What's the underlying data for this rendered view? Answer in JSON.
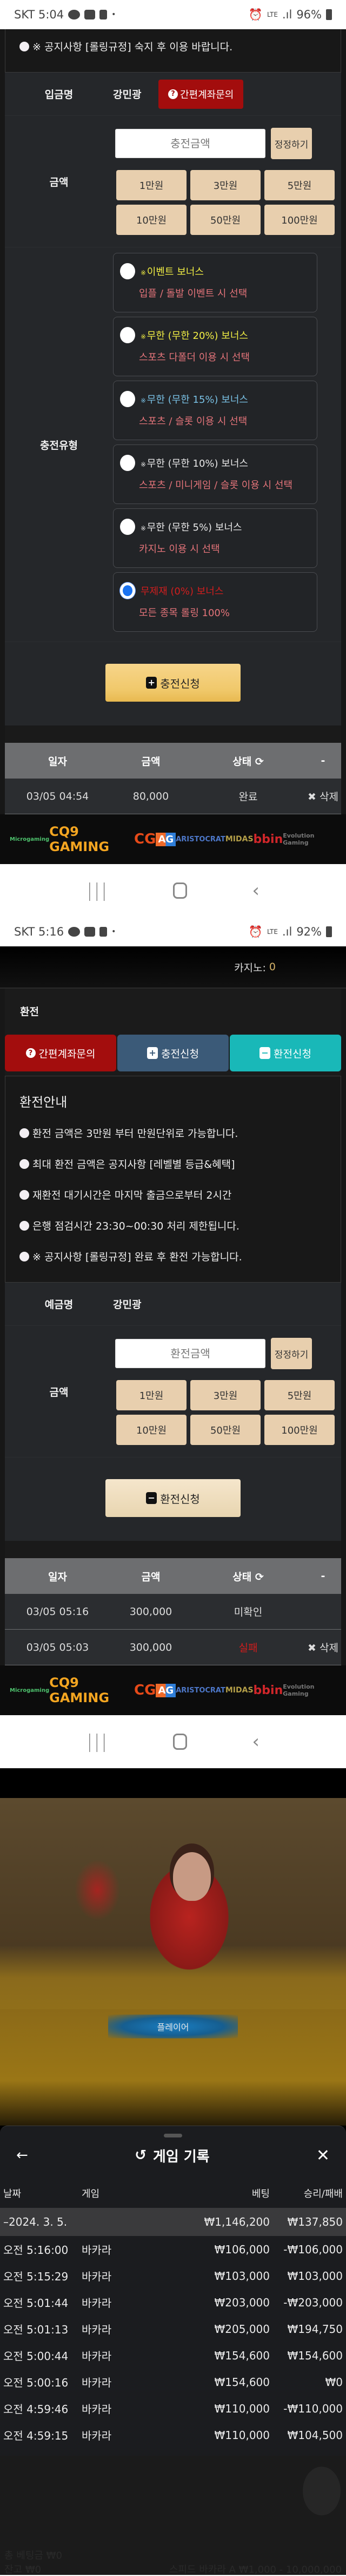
{
  "screen1": {
    "status": {
      "carrier_time": "SKT 5:04",
      "network": "LTE",
      "battery": "96%"
    },
    "notice": "※ 공지사항 [롤링규정] 숙지 후 이용 바랍니다.",
    "depositor_label": "입금명",
    "depositor_name": "강민광",
    "inquiry_button": "간편계좌문의",
    "amount_label": "금액",
    "amount_placeholder": "충전금액",
    "fix_button": "정정하기",
    "chips": [
      "1만원",
      "3만원",
      "5만원",
      "10만원",
      "50만원",
      "100만원"
    ],
    "charge_type_label": "충전유형",
    "bonus_options": [
      {
        "title": "이벤트 보너스",
        "prefix": "※",
        "desc": "입플 / 돌발 이벤트 시 선택",
        "color": "#f2ef44",
        "selected": false
      },
      {
        "title": "무한 (무한 20%) 보너스",
        "prefix": "※",
        "desc": "스포츠 다폴더 이용 시 선택",
        "color": "#f2ef44",
        "selected": false
      },
      {
        "title": "무한 (무한 15%) 보너스",
        "prefix": "※",
        "desc": "스포츠 / 슬롯 이용 시 선택",
        "color": "#7ac2e6",
        "selected": false
      },
      {
        "title": "무한 (무한 10%) 보너스",
        "prefix": "※",
        "desc": "스포츠 / 미니게임 / 슬롯 이용 시 선택",
        "color": "#e9e9e9",
        "selected": false
      },
      {
        "title": "무한 (무한 5%) 보너스",
        "prefix": "※",
        "desc": "카지노 이용 시 선택",
        "color": "#e9e9e9",
        "selected": false
      },
      {
        "title": "무제재 (0%) 보너스",
        "prefix": "",
        "desc": "모든 종목 롤링 100%",
        "color": "#d11e1e",
        "selected": true
      }
    ],
    "submit_button": "충전신청",
    "table": {
      "headers": [
        "일자",
        "금액",
        "상태",
        "-"
      ],
      "rows": [
        {
          "date": "03/05 04:54",
          "amount": "80,000",
          "status": "완료",
          "action": "삭제"
        }
      ]
    }
  },
  "providers": [
    "Microgaming",
    "CQ9 GAMING",
    "CG",
    "AG",
    "ARISTOCRAT",
    "MIDAS",
    "bbin",
    "Evolution Gaming"
  ],
  "screen2": {
    "status": {
      "carrier_time": "SKT 5:16",
      "network": "LTE",
      "battery": "92%"
    },
    "casino_label": "카지노:",
    "casino_value": "0",
    "section_title": "환전",
    "tabs": [
      "간편계좌문의",
      "충전신청",
      "환전신청"
    ],
    "info_title": "환전안내",
    "info_items": [
      "환전 금액은 3만원 부터 만원단위로 가능합니다.",
      "최대 환전 금액은 공지사항 [레벨별 등급&혜택]",
      "재환전 대기시간은 마지막 출금으로부터 2시간",
      "은행 점검시간 23:30~00:30 처리 제한됩니다.",
      "※ 공지사항 [롤링규정] 완료 후 환전 가능합니다."
    ],
    "account_label": "예금명",
    "account_name": "강민광",
    "amount_label": "금액",
    "amount_placeholder": "환전금액",
    "fix_button": "정정하기",
    "chips": [
      "1만원",
      "3만원",
      "5만원",
      "10만원",
      "50만원",
      "100만원"
    ],
    "submit_button": "환전신청",
    "table": {
      "headers": [
        "일자",
        "금액",
        "상태",
        "-"
      ],
      "rows": [
        {
          "date": "03/05 05:16",
          "amount": "300,000",
          "status": "미확인",
          "action": ""
        },
        {
          "date": "03/05 05:03",
          "amount": "300,000",
          "status": "실패",
          "action": "삭제"
        }
      ]
    }
  },
  "screen3": {
    "bet_spot_label": "플레이어",
    "sheet_title": "게임 기록",
    "columns": [
      "날짜",
      "게임",
      "베팅",
      "승리/패배"
    ],
    "total": {
      "date": "–2024. 3. 5.",
      "bet": "₩1,146,200",
      "result": "₩137,850"
    },
    "records": [
      {
        "time": "오전 5:16:00",
        "game": "바카라",
        "bet": "₩106,000",
        "result": "-₩106,000"
      },
      {
        "time": "오전 5:15:29",
        "game": "바카라",
        "bet": "₩103,000",
        "result": "₩103,000"
      },
      {
        "time": "오전 5:01:44",
        "game": "바카라",
        "bet": "₩203,000",
        "result": "-₩203,000"
      },
      {
        "time": "오전 5:01:13",
        "game": "바카라",
        "bet": "₩205,000",
        "result": "₩194,750"
      },
      {
        "time": "오전 5:00:44",
        "game": "바카라",
        "bet": "₩154,600",
        "result": "₩154,600"
      },
      {
        "time": "오전 5:00:16",
        "game": "바카라",
        "bet": "₩154,600",
        "result": "₩0"
      },
      {
        "time": "오전 4:59:46",
        "game": "바카라",
        "bet": "₩110,000",
        "result": "-₩110,000"
      },
      {
        "time": "오전 4:59:15",
        "game": "바카라",
        "bet": "₩110,000",
        "result": "₩104,500"
      }
    ],
    "footer_faint": {
      "total_bet": "총 베팅금 ₩0",
      "balance": "잔고 ₩0",
      "table_name": "스피드 바카라 A ₩1,000 - 10,000,000"
    }
  }
}
